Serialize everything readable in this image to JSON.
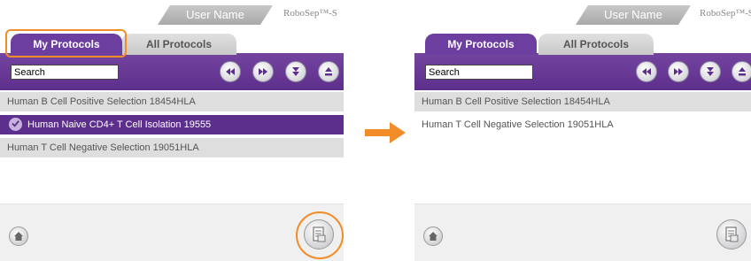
{
  "left_screen": {
    "user_name": "User Name",
    "brand": "RoboSep™-S",
    "tabs": [
      {
        "label": "My Protocols",
        "active": true
      },
      {
        "label": "All Protocols",
        "active": false
      }
    ],
    "search": {
      "value": "Search"
    },
    "nav_buttons": [
      "rewind-icon",
      "fast-forward-icon",
      "scroll-down-icon",
      "scroll-up-icon"
    ],
    "protocols": [
      {
        "label": "Human B Cell Positive Selection 18454HLA",
        "selected": false
      },
      {
        "label": "Human Naive CD4+ T Cell Isolation 19555",
        "selected": true
      },
      {
        "label": "Human T Cell Negative Selection 19051HLA",
        "selected": false
      }
    ]
  },
  "right_screen": {
    "user_name": "User Name",
    "brand": "RoboSep™-S",
    "tabs": [
      {
        "label": "My Protocols",
        "active": true
      },
      {
        "label": "All Protocols",
        "active": false
      }
    ],
    "search": {
      "value": "Search"
    },
    "protocols": [
      {
        "label": "Human B Cell Positive Selection 18454HLA",
        "selected": false
      },
      {
        "label": "Human T Cell Negative Selection 19051HLA",
        "selected": false
      }
    ]
  },
  "colors": {
    "accent": "#6c3e9f",
    "highlight": "#f28c28",
    "row_grey": "#dedede"
  }
}
